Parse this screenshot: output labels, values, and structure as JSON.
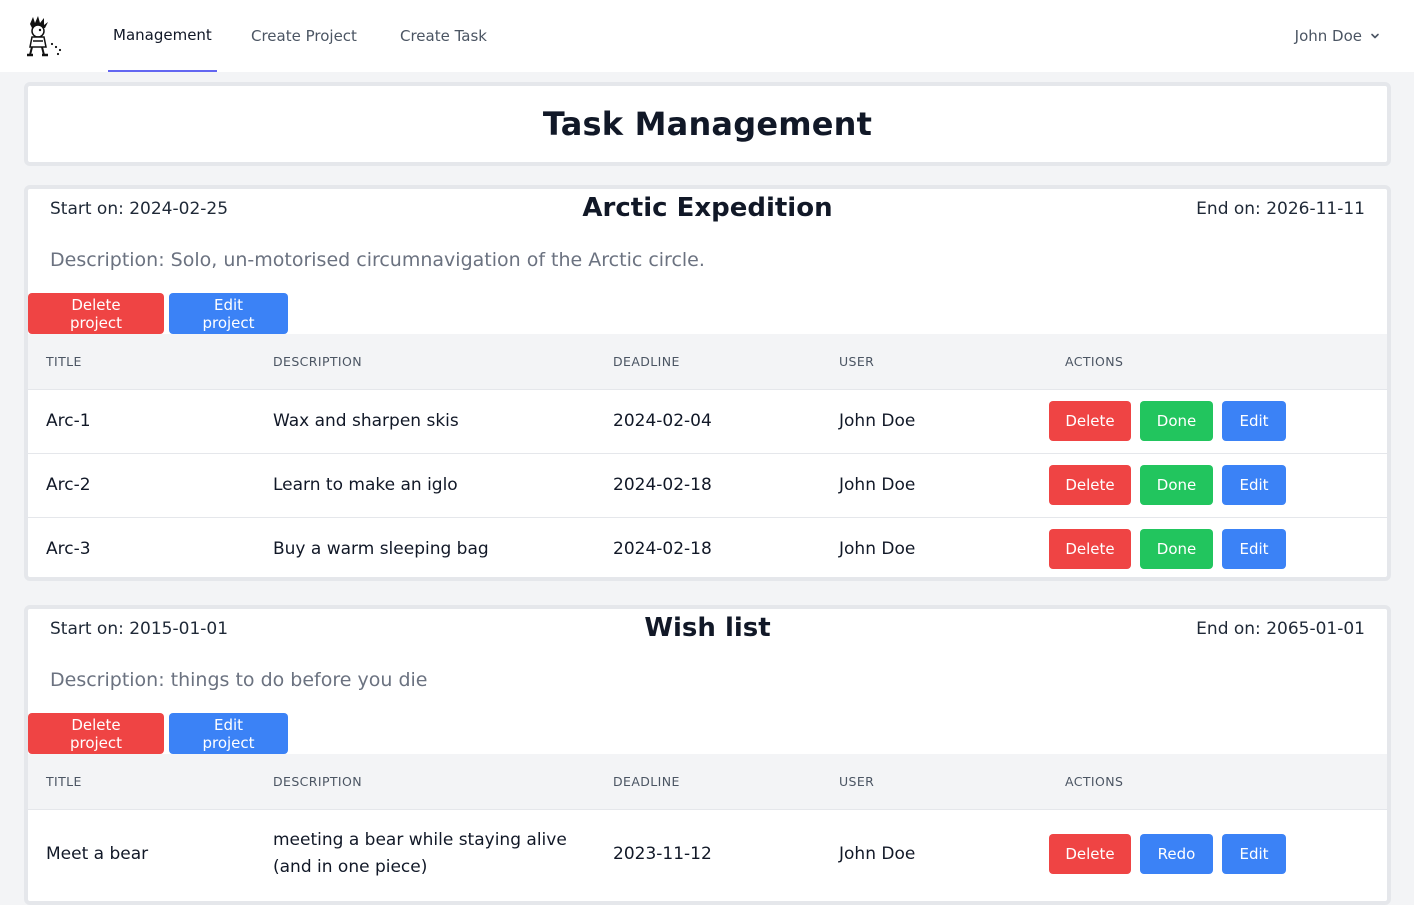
{
  "nav": {
    "links": [
      {
        "label": "Management",
        "active": true
      },
      {
        "label": "Create Project",
        "active": false
      },
      {
        "label": "Create Task",
        "active": false
      }
    ],
    "user": "John Doe"
  },
  "page_title": "Task Management",
  "table_headers": [
    "TITLE",
    "DESCRIPTION",
    "DEADLINE",
    "USER",
    "ACTIONS"
  ],
  "projects": [
    {
      "start": "Start on: 2024-02-25",
      "name": "Arctic Expedition",
      "end": "End on: 2026-11-11",
      "description": "Description: Solo, un-motorised circumnavigation of the Arctic circle.",
      "delete_label": "Delete project",
      "edit_label": "Edit project",
      "tasks": [
        {
          "title": "Arc-1",
          "description": "Wax and sharpen skis",
          "deadline": "2024-02-04",
          "user": "John Doe",
          "delete": "Delete",
          "status_action": "Done",
          "edit": "Edit"
        },
        {
          "title": "Arc-2",
          "description": "Learn to make an iglo",
          "deadline": "2024-02-18",
          "user": "John Doe",
          "delete": "Delete",
          "status_action": "Done",
          "edit": "Edit"
        },
        {
          "title": "Arc-3",
          "description": "Buy a warm sleeping bag",
          "deadline": "2024-02-18",
          "user": "John Doe",
          "delete": "Delete",
          "status_action": "Done",
          "edit": "Edit"
        }
      ]
    },
    {
      "start": "Start on: 2015-01-01",
      "name": "Wish list",
      "end": "End on: 2065-01-01",
      "description": "Description: things to do before you die",
      "delete_label": "Delete project",
      "edit_label": "Edit project",
      "tasks": [
        {
          "title": "Meet a bear",
          "description": "meeting a bear while staying alive (and in one piece)",
          "deadline": "2023-11-12",
          "user": "John Doe",
          "delete": "Delete",
          "status_action": "Redo",
          "edit": "Edit"
        }
      ]
    }
  ],
  "colors": {
    "danger": "#ef4444",
    "primary": "#3b82f6",
    "success": "#22c55e",
    "active_tab": "#6366f1"
  },
  "icons": {
    "logo": "cartoon-character-logo",
    "user_menu": "chevron-down-icon"
  }
}
